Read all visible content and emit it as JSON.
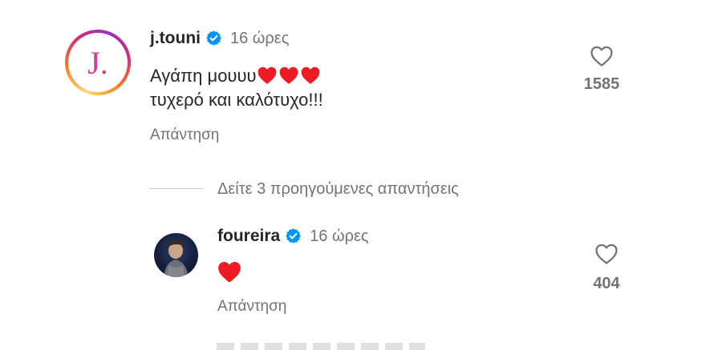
{
  "comment": {
    "username": "j.touni",
    "avatar_letter": "J.",
    "time": "16 ώρες",
    "text_line1": "Αγάπη μουυυ",
    "text_line2": "τυχερό και καλότυχο!!!",
    "reply_label": "Απάντηση",
    "likes": "1585",
    "verified": true
  },
  "view_replies": "Δείτε 3 προηγούμενες απαντήσεις",
  "reply": {
    "username": "foureira",
    "time": "16 ώρες",
    "reply_label": "Απάντηση",
    "likes": "404",
    "verified": true
  },
  "colors": {
    "verified_blue": "#0095f6",
    "heart_red": "#ed1c24",
    "muted_text": "#737373"
  },
  "icons": {
    "like": "heart-outline-icon",
    "emoji": "red-heart-emoji",
    "verified": "verified-badge-icon"
  }
}
